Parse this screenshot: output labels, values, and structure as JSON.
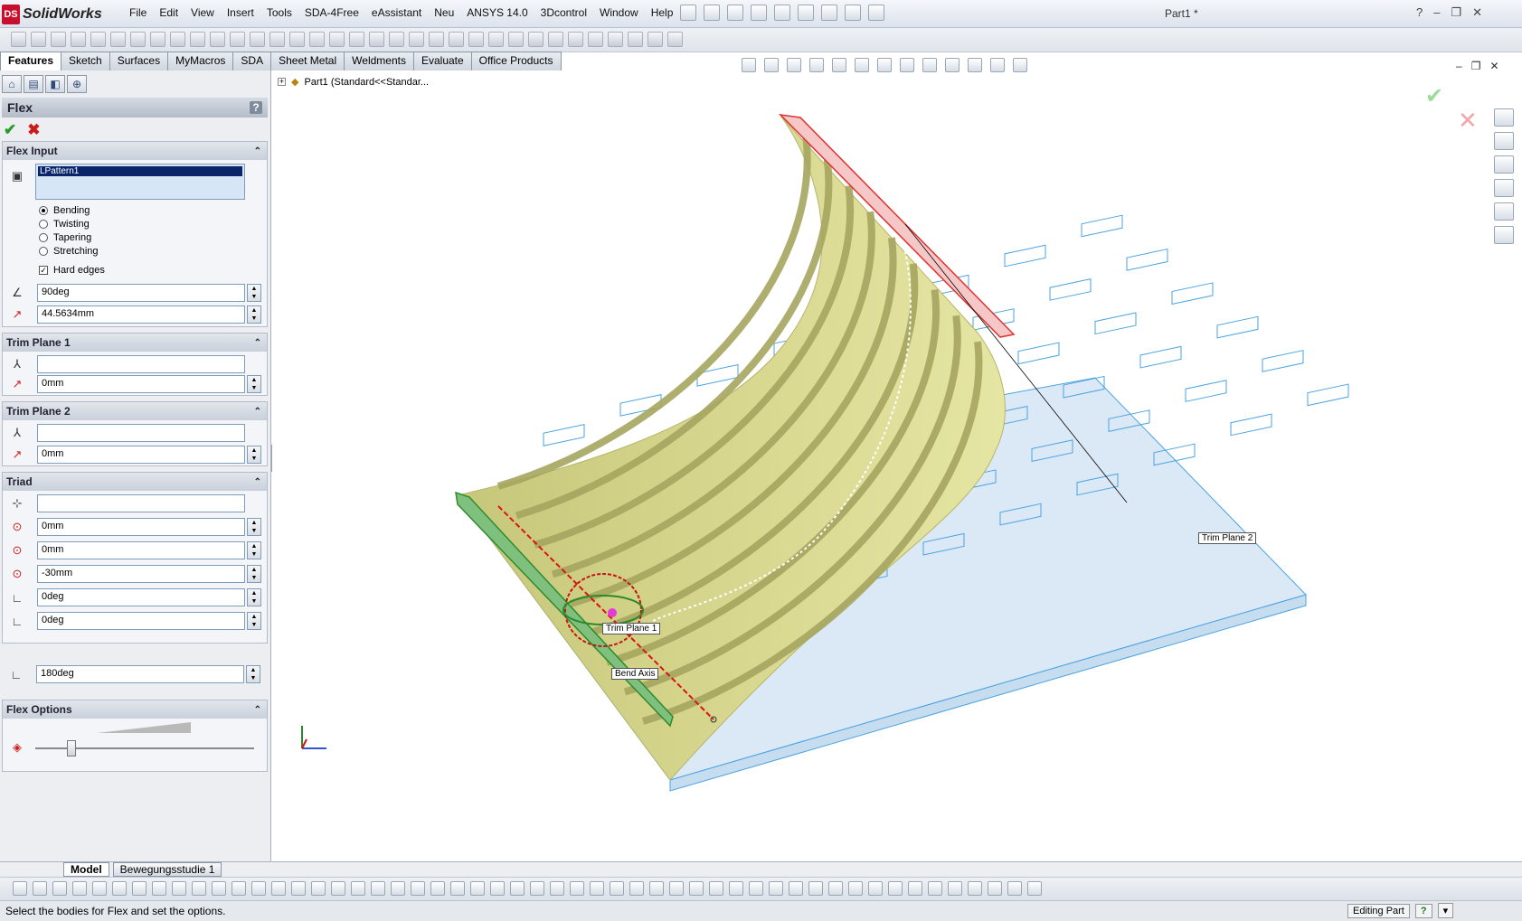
{
  "app": {
    "logo_text": "SolidWorks",
    "logo_mark": "DS",
    "document_title": "Part1 *"
  },
  "menu": [
    "File",
    "Edit",
    "View",
    "Insert",
    "Tools",
    "SDA-4Free",
    "eAssistant",
    "Neu",
    "ANSYS 14.0",
    "3Dcontrol",
    "Window",
    "Help"
  ],
  "command_tabs": [
    "Features",
    "Sketch",
    "Surfaces",
    "MyMacros",
    "SDA",
    "Sheet Metal",
    "Weldments",
    "Evaluate",
    "Office Products"
  ],
  "panel": {
    "title": "Flex",
    "help": "?",
    "flex_input": {
      "header": "Flex Input",
      "selection": "LPattern1",
      "options": [
        {
          "label": "Bending",
          "selected": true
        },
        {
          "label": "Twisting",
          "selected": false
        },
        {
          "label": "Tapering",
          "selected": false
        },
        {
          "label": "Stretching",
          "selected": false
        }
      ],
      "hard_edges_label": "Hard edges",
      "hard_edges_checked": true,
      "angle": "90deg",
      "radius": "44.5634mm"
    },
    "trim_plane_1": {
      "header": "Trim Plane 1",
      "reference": "",
      "offset": "0mm"
    },
    "trim_plane_2": {
      "header": "Trim Plane 2",
      "reference": "",
      "offset": "0mm"
    },
    "triad": {
      "header": "Triad",
      "reference": "",
      "x": "0mm",
      "y": "0mm",
      "z": "-30mm",
      "rot_x": "0deg",
      "rot_y": "0deg",
      "rot_z": "180deg"
    },
    "flex_options": {
      "header": "Flex Options",
      "accuracy_level": 0.15
    }
  },
  "viewport": {
    "tree_label": "Part1  (Standard<<Standar...",
    "labels": {
      "trim_plane_1": "Trim Plane 1",
      "trim_plane_2": "Trim Plane 2",
      "bend_axis": "Bend Axis"
    },
    "colors": {
      "flexed_body": "#d9d98a",
      "original_body": "#4aa3e0",
      "trim_plane_1": "#2e8b2e",
      "trim_plane_2": "#e03030"
    }
  },
  "bottom_tabs": [
    "Model",
    "Bewegungsstudie 1"
  ],
  "status": {
    "message": "Select the bodies for Flex and set the options.",
    "mode": "Editing Part",
    "help": "?"
  }
}
